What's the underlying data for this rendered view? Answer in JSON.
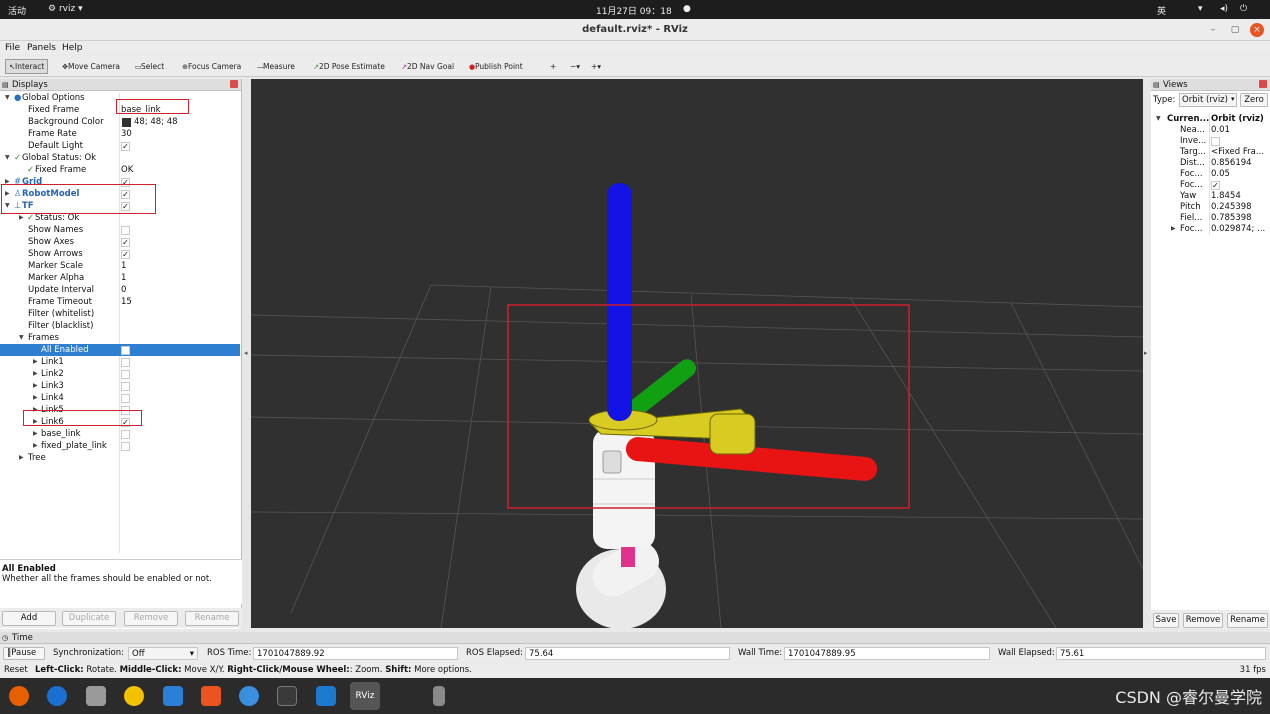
{
  "topbar": {
    "activities": "活动",
    "app_name": "rviz",
    "datetime": "11月27日  09：18",
    "lang": "英"
  },
  "window": {
    "title": "default.rviz* - RViz"
  },
  "menu": {
    "file": "File",
    "panels": "Panels",
    "help": "Help"
  },
  "toolbar": {
    "interact": "Interact",
    "move_camera": "Move Camera",
    "select": "Select",
    "focus_camera": "Focus Camera",
    "measure": "Measure",
    "pose_estimate": "2D Pose Estimate",
    "nav_goal": "2D Nav Goal",
    "publish_point": "Publish Point"
  },
  "displays": {
    "title": "Displays",
    "global_options": "Global Options",
    "fixed_frame_label": "Fixed Frame",
    "fixed_frame_value": "base_link",
    "bg_color_label": "Background Color",
    "bg_color_value": "48; 48; 48",
    "bg_color_hex": "#303030",
    "frame_rate_label": "Frame Rate",
    "frame_rate_value": "30",
    "default_light_label": "Default Light",
    "global_status": "Global Status: Ok",
    "gs_fixed_frame_label": "Fixed Frame",
    "gs_fixed_frame_value": "OK",
    "grid": "Grid",
    "robot_model": "RobotModel",
    "tf": "TF",
    "status": "Status: Ok",
    "show_names": "Show Names",
    "show_axes": "Show Axes",
    "show_arrows": "Show Arrows",
    "marker_scale_label": "Marker Scale",
    "marker_scale_value": "1",
    "marker_alpha_label": "Marker Alpha",
    "marker_alpha_value": "1",
    "update_interval_label": "Update Interval",
    "update_interval_value": "0",
    "frame_timeout_label": "Frame Timeout",
    "frame_timeout_value": "15",
    "filter_white": "Filter (whitelist)",
    "filter_black": "Filter (blacklist)",
    "frames": "Frames",
    "all_enabled": "All Enabled",
    "links": [
      "Link1",
      "Link2",
      "Link3",
      "Link4",
      "Link5",
      "Link6",
      "base_link",
      "fixed_plate_link"
    ],
    "tree": "Tree",
    "desc_title": "All Enabled",
    "desc_text": "Whether all the frames should be enabled or not.",
    "btn_add": "Add",
    "btn_duplicate": "Duplicate",
    "btn_remove": "Remove",
    "btn_rename": "Rename"
  },
  "views": {
    "title": "Views",
    "type_label": "Type:",
    "type_value": "Orbit (rviz)",
    "zero": "Zero",
    "current_label": "Curren...",
    "current_value": "Orbit (rviz)",
    "props": [
      [
        "Nea...",
        "0.01"
      ],
      [
        "Inve...",
        ""
      ],
      [
        "Targ...",
        "<Fixed Fra..."
      ],
      [
        "Dist...",
        "0.856194"
      ],
      [
        "Foc...",
        "0.05"
      ],
      [
        "Foc...",
        ""
      ],
      [
        "Yaw",
        "1.8454"
      ],
      [
        "Pitch",
        "0.245398"
      ],
      [
        "Fiel...",
        "0.785398"
      ],
      [
        "Foc...",
        "0.029874; ..."
      ]
    ],
    "btn_save": "Save",
    "btn_remove": "Remove",
    "btn_rename": "Rename"
  },
  "time": {
    "title": "Time",
    "pause": "Pause",
    "sync_label": "Synchronization:",
    "sync_value": "Off",
    "ros_time_label": "ROS Time:",
    "ros_time": "1701047889.92",
    "ros_elapsed_label": "ROS Elapsed:",
    "ros_elapsed": "75.64",
    "wall_time_label": "Wall Time:",
    "wall_time": "1701047889.95",
    "wall_elapsed_label": "Wall Elapsed:",
    "wall_elapsed": "75.61"
  },
  "status": {
    "reset": "Reset",
    "left": "Left-Click:",
    "left_d": " Rotate. ",
    "mid": "Middle-Click:",
    "mid_d": " Move X/Y. ",
    "right": "Right-Click/Mouse Wheel:",
    "right_d": ": Zoom. ",
    "shift": "Shift:",
    "shift_d": " More options.",
    "fps": "31 fps"
  },
  "watermark": "CSDN @睿尔曼学院"
}
